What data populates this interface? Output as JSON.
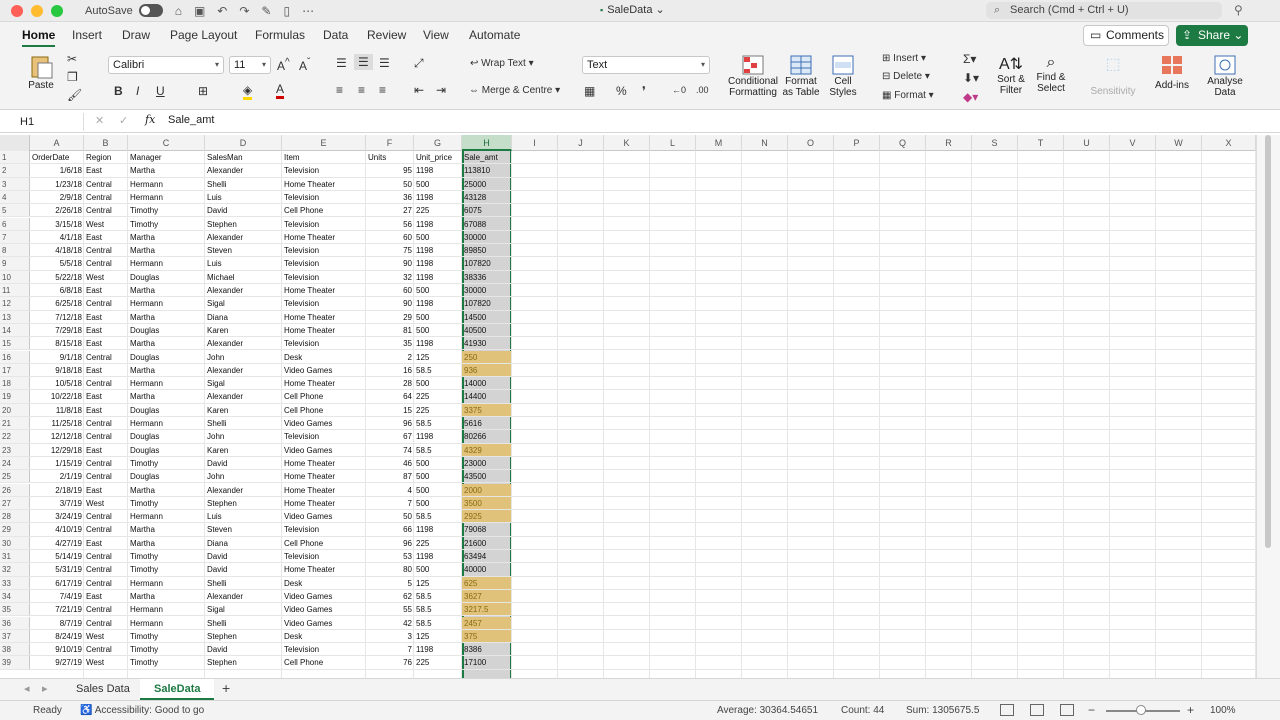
{
  "titlebar": {
    "autosave_label": "AutoSave",
    "doc_title": "SaleData",
    "search_placeholder": "Search (Cmd + Ctrl + U)"
  },
  "ribbon_tabs": [
    "Home",
    "Insert",
    "Draw",
    "Page Layout",
    "Formulas",
    "Data",
    "Review",
    "View",
    "Automate"
  ],
  "comments_label": "Comments",
  "share_label": "Share",
  "ribbon": {
    "paste": "Paste",
    "font_name": "Calibri",
    "font_size": "11",
    "wrap_text": "Wrap Text",
    "merge_centre": "Merge & Centre",
    "number_format": "Text",
    "conditional_formatting": [
      "Conditional",
      "Formatting"
    ],
    "format_as_table": [
      "Format",
      "as Table"
    ],
    "cell_styles": [
      "Cell",
      "Styles"
    ],
    "insert": "Insert",
    "delete": "Delete",
    "format": "Format",
    "sort_filter": [
      "Sort &",
      "Filter"
    ],
    "find_select": [
      "Find &",
      "Select"
    ],
    "sensitivity": "Sensitivity",
    "add_ins": "Add-ins",
    "analyse_data": [
      "Analyse",
      "Data"
    ]
  },
  "formula_bar": {
    "name_box": "H1",
    "fx": "fx",
    "formula": "Sale_amt"
  },
  "columns": [
    "A",
    "B",
    "C",
    "D",
    "E",
    "F",
    "G",
    "H",
    "I",
    "J",
    "K",
    "L",
    "M",
    "N",
    "O",
    "P",
    "Q",
    "R",
    "S",
    "T",
    "U",
    "V",
    "W",
    "X"
  ],
  "header_row": [
    "OrderDate",
    "Region",
    "Manager",
    "SalesMan",
    "Item",
    "Units",
    "Unit_price",
    "Sale_amt"
  ],
  "rows": [
    [
      "1/6/18",
      "East",
      "Martha",
      "Alexander",
      "Television",
      "95",
      "1198",
      "113810",
      false
    ],
    [
      "1/23/18",
      "Central",
      "Hermann",
      "Shelli",
      "Home Theater",
      "50",
      "500",
      "25000",
      false
    ],
    [
      "2/9/18",
      "Central",
      "Hermann",
      "Luis",
      "Television",
      "36",
      "1198",
      "43128",
      false
    ],
    [
      "2/26/18",
      "Central",
      "Timothy",
      "David",
      "Cell Phone",
      "27",
      "225",
      "6075",
      false
    ],
    [
      "3/15/18",
      "West",
      "Timothy",
      "Stephen",
      "Television",
      "56",
      "1198",
      "67088",
      false
    ],
    [
      "4/1/18",
      "East",
      "Martha",
      "Alexander",
      "Home Theater",
      "60",
      "500",
      "30000",
      false
    ],
    [
      "4/18/18",
      "Central",
      "Martha",
      "Steven",
      "Television",
      "75",
      "1198",
      "89850",
      false
    ],
    [
      "5/5/18",
      "Central",
      "Hermann",
      "Luis",
      "Television",
      "90",
      "1198",
      "107820",
      false
    ],
    [
      "5/22/18",
      "West",
      "Douglas",
      "Michael",
      "Television",
      "32",
      "1198",
      "38336",
      false
    ],
    [
      "6/8/18",
      "East",
      "Martha",
      "Alexander",
      "Home Theater",
      "60",
      "500",
      "30000",
      false
    ],
    [
      "6/25/18",
      "Central",
      "Hermann",
      "Sigal",
      "Television",
      "90",
      "1198",
      "107820",
      false
    ],
    [
      "7/12/18",
      "East",
      "Martha",
      "Diana",
      "Home Theater",
      "29",
      "500",
      "14500",
      false
    ],
    [
      "7/29/18",
      "East",
      "Douglas",
      "Karen",
      "Home Theater",
      "81",
      "500",
      "40500",
      false
    ],
    [
      "8/15/18",
      "East",
      "Martha",
      "Alexander",
      "Television",
      "35",
      "1198",
      "41930",
      false
    ],
    [
      "9/1/18",
      "Central",
      "Douglas",
      "John",
      "Desk",
      "2",
      "125",
      "250",
      true
    ],
    [
      "9/18/18",
      "East",
      "Martha",
      "Alexander",
      "Video Games",
      "16",
      "58.5",
      "936",
      true
    ],
    [
      "10/5/18",
      "Central",
      "Hermann",
      "Sigal",
      "Home Theater",
      "28",
      "500",
      "14000",
      false
    ],
    [
      "10/22/18",
      "East",
      "Martha",
      "Alexander",
      "Cell Phone",
      "64",
      "225",
      "14400",
      false
    ],
    [
      "11/8/18",
      "East",
      "Douglas",
      "Karen",
      "Cell Phone",
      "15",
      "225",
      "3375",
      true
    ],
    [
      "11/25/18",
      "Central",
      "Hermann",
      "Shelli",
      "Video Games",
      "96",
      "58.5",
      "5616",
      false
    ],
    [
      "12/12/18",
      "Central",
      "Douglas",
      "John",
      "Television",
      "67",
      "1198",
      "80266",
      false
    ],
    [
      "12/29/18",
      "East",
      "Douglas",
      "Karen",
      "Video Games",
      "74",
      "58.5",
      "4329",
      true
    ],
    [
      "1/15/19",
      "Central",
      "Timothy",
      "David",
      "Home Theater",
      "46",
      "500",
      "23000",
      false
    ],
    [
      "2/1/19",
      "Central",
      "Douglas",
      "John",
      "Home Theater",
      "87",
      "500",
      "43500",
      false
    ],
    [
      "2/18/19",
      "East",
      "Martha",
      "Alexander",
      "Home Theater",
      "4",
      "500",
      "2000",
      true
    ],
    [
      "3/7/19",
      "West",
      "Timothy",
      "Stephen",
      "Home Theater",
      "7",
      "500",
      "3500",
      true
    ],
    [
      "3/24/19",
      "Central",
      "Hermann",
      "Luis",
      "Video Games",
      "50",
      "58.5",
      "2925",
      true
    ],
    [
      "4/10/19",
      "Central",
      "Martha",
      "Steven",
      "Television",
      "66",
      "1198",
      "79068",
      false
    ],
    [
      "4/27/19",
      "East",
      "Martha",
      "Diana",
      "Cell Phone",
      "96",
      "225",
      "21600",
      false
    ],
    [
      "5/14/19",
      "Central",
      "Timothy",
      "David",
      "Television",
      "53",
      "1198",
      "63494",
      false
    ],
    [
      "5/31/19",
      "Central",
      "Timothy",
      "David",
      "Home Theater",
      "80",
      "500",
      "40000",
      false
    ],
    [
      "6/17/19",
      "Central",
      "Hermann",
      "Shelli",
      "Desk",
      "5",
      "125",
      "625",
      true
    ],
    [
      "7/4/19",
      "East",
      "Martha",
      "Alexander",
      "Video Games",
      "62",
      "58.5",
      "3627",
      true
    ],
    [
      "7/21/19",
      "Central",
      "Hermann",
      "Sigal",
      "Video Games",
      "55",
      "58.5",
      "3217.5",
      true
    ],
    [
      "8/7/19",
      "Central",
      "Hermann",
      "Shelli",
      "Video Games",
      "42",
      "58.5",
      "2457",
      true
    ],
    [
      "8/24/19",
      "West",
      "Timothy",
      "Stephen",
      "Desk",
      "3",
      "125",
      "375",
      true
    ],
    [
      "9/10/19",
      "Central",
      "Timothy",
      "David",
      "Television",
      "7",
      "1198",
      "8386",
      false
    ],
    [
      "9/27/19",
      "West",
      "Timothy",
      "Stephen",
      "Cell Phone",
      "76",
      "225",
      "17100",
      false
    ]
  ],
  "sheets": [
    "Sales Data",
    "SaleData"
  ],
  "active_sheet": "SaleData",
  "status": {
    "ready": "Ready",
    "accessibility": "Accessibility: Good to go",
    "average": "Average: 30364.54651",
    "count": "Count: 44",
    "sum": "Sum: 1305675.5",
    "zoom": "100%"
  },
  "colors": {
    "accent": "#1d7a43",
    "highlight": "#e0c27a",
    "selection": "#d3d3d3"
  }
}
